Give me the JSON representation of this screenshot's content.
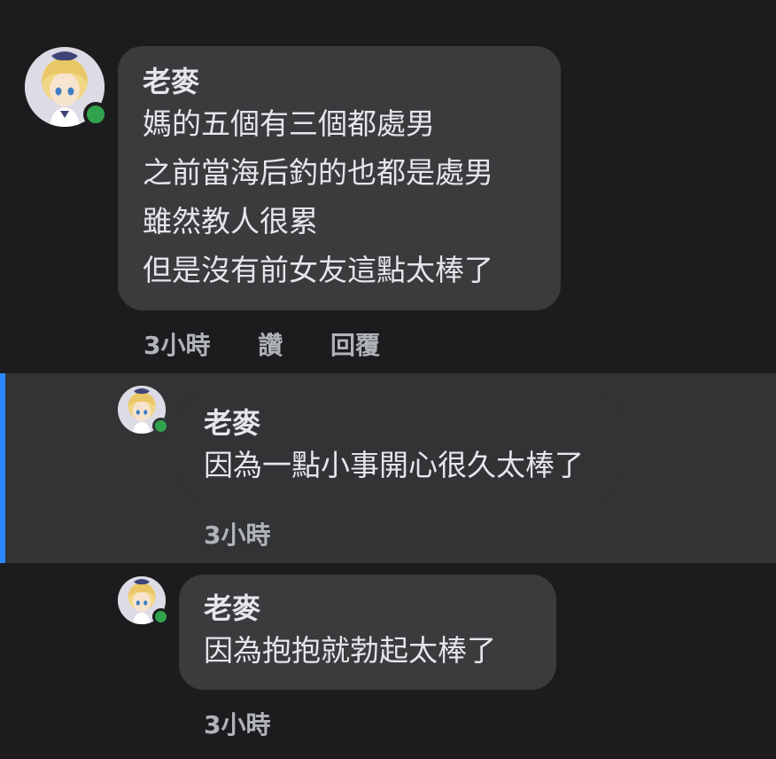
{
  "top_fragment": "",
  "comments": [
    {
      "author": "老麥",
      "lines": [
        "媽的五個有三個都處男",
        "之前當海后釣的也都是處男",
        "雖然教人很累",
        "但是沒有前女友這點太棒了"
      ],
      "time": "3小時",
      "like_label": "讚",
      "reply_label": "回覆"
    },
    {
      "author": "老麥",
      "lines": [
        "因為一點小事開心很久太棒了"
      ],
      "time": "3小時",
      "highlighted": true
    },
    {
      "author": "老麥",
      "lines": [
        "因為抱抱就勃起太棒了"
      ],
      "time": "3小時"
    }
  ],
  "colors": {
    "background": "#1c1c1e",
    "bubble": "#3a3b3c",
    "highlight": "#323335",
    "accent_bar": "#2d88ff",
    "online": "#31a24c"
  },
  "icons": [
    "avatar",
    "online-status-icon"
  ]
}
